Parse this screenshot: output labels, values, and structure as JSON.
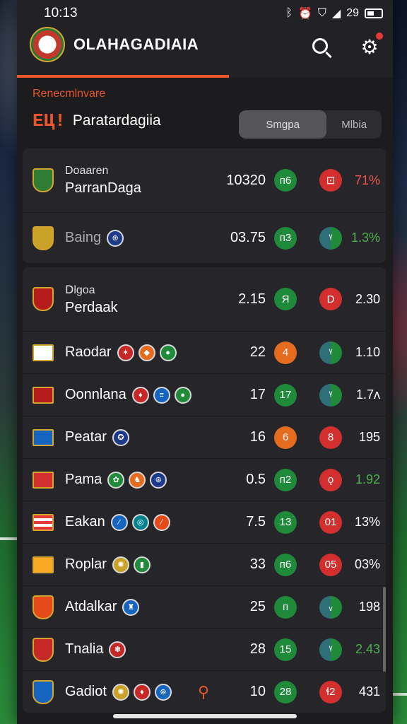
{
  "status": {
    "time": "10:13",
    "battery": "29",
    "icons": [
      "bluetooth-icon",
      "alarm-icon",
      "shield-icon",
      "signal-icon",
      "battery-icon"
    ]
  },
  "header": {
    "title": "OLAHAGADIAIA",
    "accent": "#e8562a"
  },
  "section": {
    "eyebrow": "Renecmlnvare",
    "mark": "ЕЦ!",
    "title": "Paratardagiia",
    "toggle": [
      "Smgpa",
      "Mlbia"
    ]
  },
  "groups": [
    {
      "rows": [
        {
          "label": "Doaaren",
          "name": "ParranDaga",
          "stat": "10320",
          "d1": "ᴨ6",
          "d1c": "green",
          "d2": "⊡",
          "d2c": "red",
          "pct": "71%",
          "pctc": "red",
          "badge": "#2e7d32"
        },
        {
          "label": "",
          "name": "Baing",
          "stat": "03.75",
          "d1": "ᴨ3",
          "d1c": "green",
          "d2": "ᵞ",
          "d2c": "teal",
          "pct": "1.3%",
          "pctc": "green",
          "badge": "#c9a227"
        }
      ]
    },
    {
      "rows": [
        {
          "label": "Ⅾlgoa",
          "name": "Perdaak",
          "stat": "2.15",
          "d1": "Я",
          "d1c": "green",
          "d2": "D",
          "d2c": "red",
          "pct": "2.30",
          "pctc": "",
          "badge": "#b71c1c"
        },
        {
          "label": "",
          "name": "Raodar",
          "stat": "22",
          "d1": "4",
          "d1c": "orange",
          "d2": "ᵞ",
          "d2c": "teal",
          "pct": "1.10",
          "pctc": "",
          "badge": "#ffffff"
        },
        {
          "label": "",
          "name": "Oonnlana",
          "stat": "17",
          "d1": "17",
          "d1c": "green",
          "d2": "ᵞ",
          "d2c": "teal",
          "pct": "1.7ʌ",
          "pctc": "",
          "badge": "#b71c1c"
        },
        {
          "label": "",
          "name": "Peatar",
          "stat": "16",
          "d1": "6",
          "d1c": "orange",
          "d2": "8",
          "d2c": "red",
          "pct": "195",
          "pctc": "",
          "badge": "#1565c0"
        },
        {
          "label": "",
          "name": "Pama",
          "stat": "0.5",
          "d1": "ᴨ2",
          "d1c": "green",
          "d2": "ǫ",
          "d2c": "red",
          "pct": "1.92",
          "pctc": "green",
          "badge": "#d32f2f"
        },
        {
          "label": "",
          "name": "Eakan",
          "stat": "7.5",
          "d1": "13",
          "d1c": "green",
          "d2": "01",
          "d2c": "red",
          "pct": "13%",
          "pctc": "",
          "badge": "#e53935"
        },
        {
          "label": "",
          "name": "Roplar",
          "stat": "33",
          "d1": "ᴨ6",
          "d1c": "green",
          "d2": "05",
          "d2c": "red",
          "pct": "03%",
          "pctc": "",
          "badge": "#f9a825"
        },
        {
          "label": "",
          "name": "Atdalkar",
          "stat": "25",
          "d1": "ᴨ",
          "d1c": "green",
          "d2": "ᵥ",
          "d2c": "teal",
          "pct": "198",
          "pctc": "",
          "badge": "#e64a19"
        },
        {
          "label": "",
          "name": "Tnalia",
          "stat": "28",
          "d1": "15",
          "d1c": "green",
          "d2": "ᵞ",
          "d2c": "teal",
          "pct": "2.43",
          "pctc": "green",
          "badge": "#c62828"
        },
        {
          "label": "",
          "name": "Gadiot",
          "stat": "10",
          "d1": "28",
          "d1c": "green",
          "d2": "ɬ2",
          "d2c": "red",
          "pct": "431",
          "pctc": "",
          "badge": "#1565c0"
        }
      ]
    }
  ]
}
